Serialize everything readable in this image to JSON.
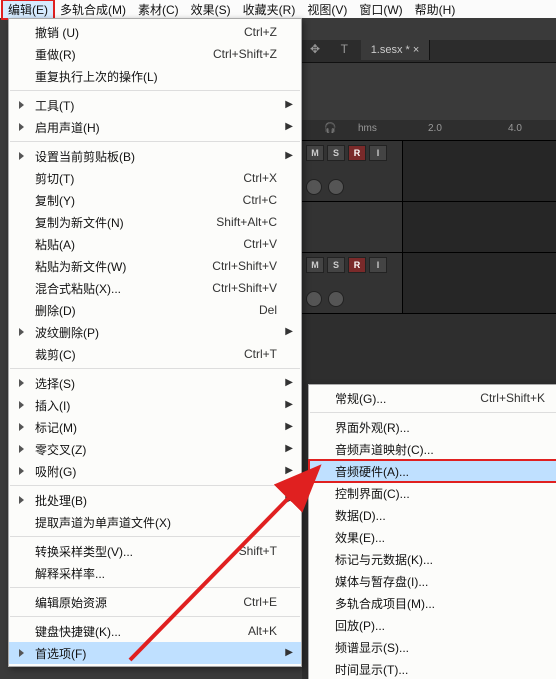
{
  "menubar": {
    "items": [
      "编辑(E)",
      "多轨合成(M)",
      "素材(C)",
      "效果(S)",
      "收藏夹(R)",
      "视图(V)",
      "窗口(W)",
      "帮助(H)"
    ]
  },
  "tab": {
    "label": "1.sesx *"
  },
  "ruler": {
    "unit": "hms",
    "ticks": [
      "2.0",
      "4.0"
    ]
  },
  "track_buttons": {
    "m": "M",
    "s": "S",
    "r": "R",
    "i": "I"
  },
  "edit_menu": [
    {
      "label": "撤销 (U)",
      "shortcut": "Ctrl+Z"
    },
    {
      "label": "重做(R)",
      "shortcut": "Ctrl+Shift+Z"
    },
    {
      "label": "重复执行上次的操作(L)",
      "shortcut": ""
    },
    {
      "sep": true
    },
    {
      "label": "工具(T)",
      "sub": true
    },
    {
      "label": "启用声道(H)",
      "sub": true
    },
    {
      "sep": true
    },
    {
      "label": "设置当前剪贴板(B)",
      "sub": true
    },
    {
      "label": "剪切(T)",
      "shortcut": "Ctrl+X"
    },
    {
      "label": "复制(Y)",
      "shortcut": "Ctrl+C"
    },
    {
      "label": "复制为新文件(N)",
      "shortcut": "Shift+Alt+C"
    },
    {
      "label": "粘贴(A)",
      "shortcut": "Ctrl+V"
    },
    {
      "label": "粘贴为新文件(W)",
      "shortcut": "Ctrl+Shift+V"
    },
    {
      "label": "混合式粘贴(X)...",
      "shortcut": "Ctrl+Shift+V"
    },
    {
      "label": "删除(D)",
      "shortcut": "Del"
    },
    {
      "label": "波纹删除(P)",
      "sub": true
    },
    {
      "label": "裁剪(C)",
      "shortcut": "Ctrl+T"
    },
    {
      "sep": true
    },
    {
      "label": "选择(S)",
      "sub": true
    },
    {
      "label": "插入(I)",
      "sub": true
    },
    {
      "label": "标记(M)",
      "sub": true
    },
    {
      "label": "零交叉(Z)",
      "sub": true
    },
    {
      "label": "吸附(G)",
      "sub": true
    },
    {
      "sep": true
    },
    {
      "label": "批处理(B)",
      "sub": true
    },
    {
      "label": "提取声道为单声道文件(X)",
      "shortcut": ""
    },
    {
      "sep": true
    },
    {
      "label": "转换采样类型(V)...",
      "shortcut": "Shift+T"
    },
    {
      "label": "解释采样率...",
      "shortcut": ""
    },
    {
      "sep": true
    },
    {
      "label": "编辑原始资源",
      "shortcut": "Ctrl+E"
    },
    {
      "sep": true
    },
    {
      "label": "键盘快捷键(K)...",
      "shortcut": "Alt+K"
    },
    {
      "label": "首选项(F)",
      "sub": true,
      "highlight": "hl"
    }
  ],
  "pref_submenu": [
    {
      "label": "常规(G)...",
      "shortcut": "Ctrl+Shift+K"
    },
    {
      "sep": true
    },
    {
      "label": "界面外观(R)..."
    },
    {
      "label": "音频声道映射(C)..."
    },
    {
      "label": "音频硬件(A)...",
      "highlight": "hlbox"
    },
    {
      "label": "控制界面(C)..."
    },
    {
      "label": "数据(D)..."
    },
    {
      "label": "效果(E)..."
    },
    {
      "label": "标记与元数据(K)..."
    },
    {
      "label": "媒体与暂存盘(I)..."
    },
    {
      "label": "多轨合成项目(M)..."
    },
    {
      "label": "回放(P)..."
    },
    {
      "label": "频谱显示(S)..."
    },
    {
      "label": "时间显示(T)..."
    }
  ]
}
